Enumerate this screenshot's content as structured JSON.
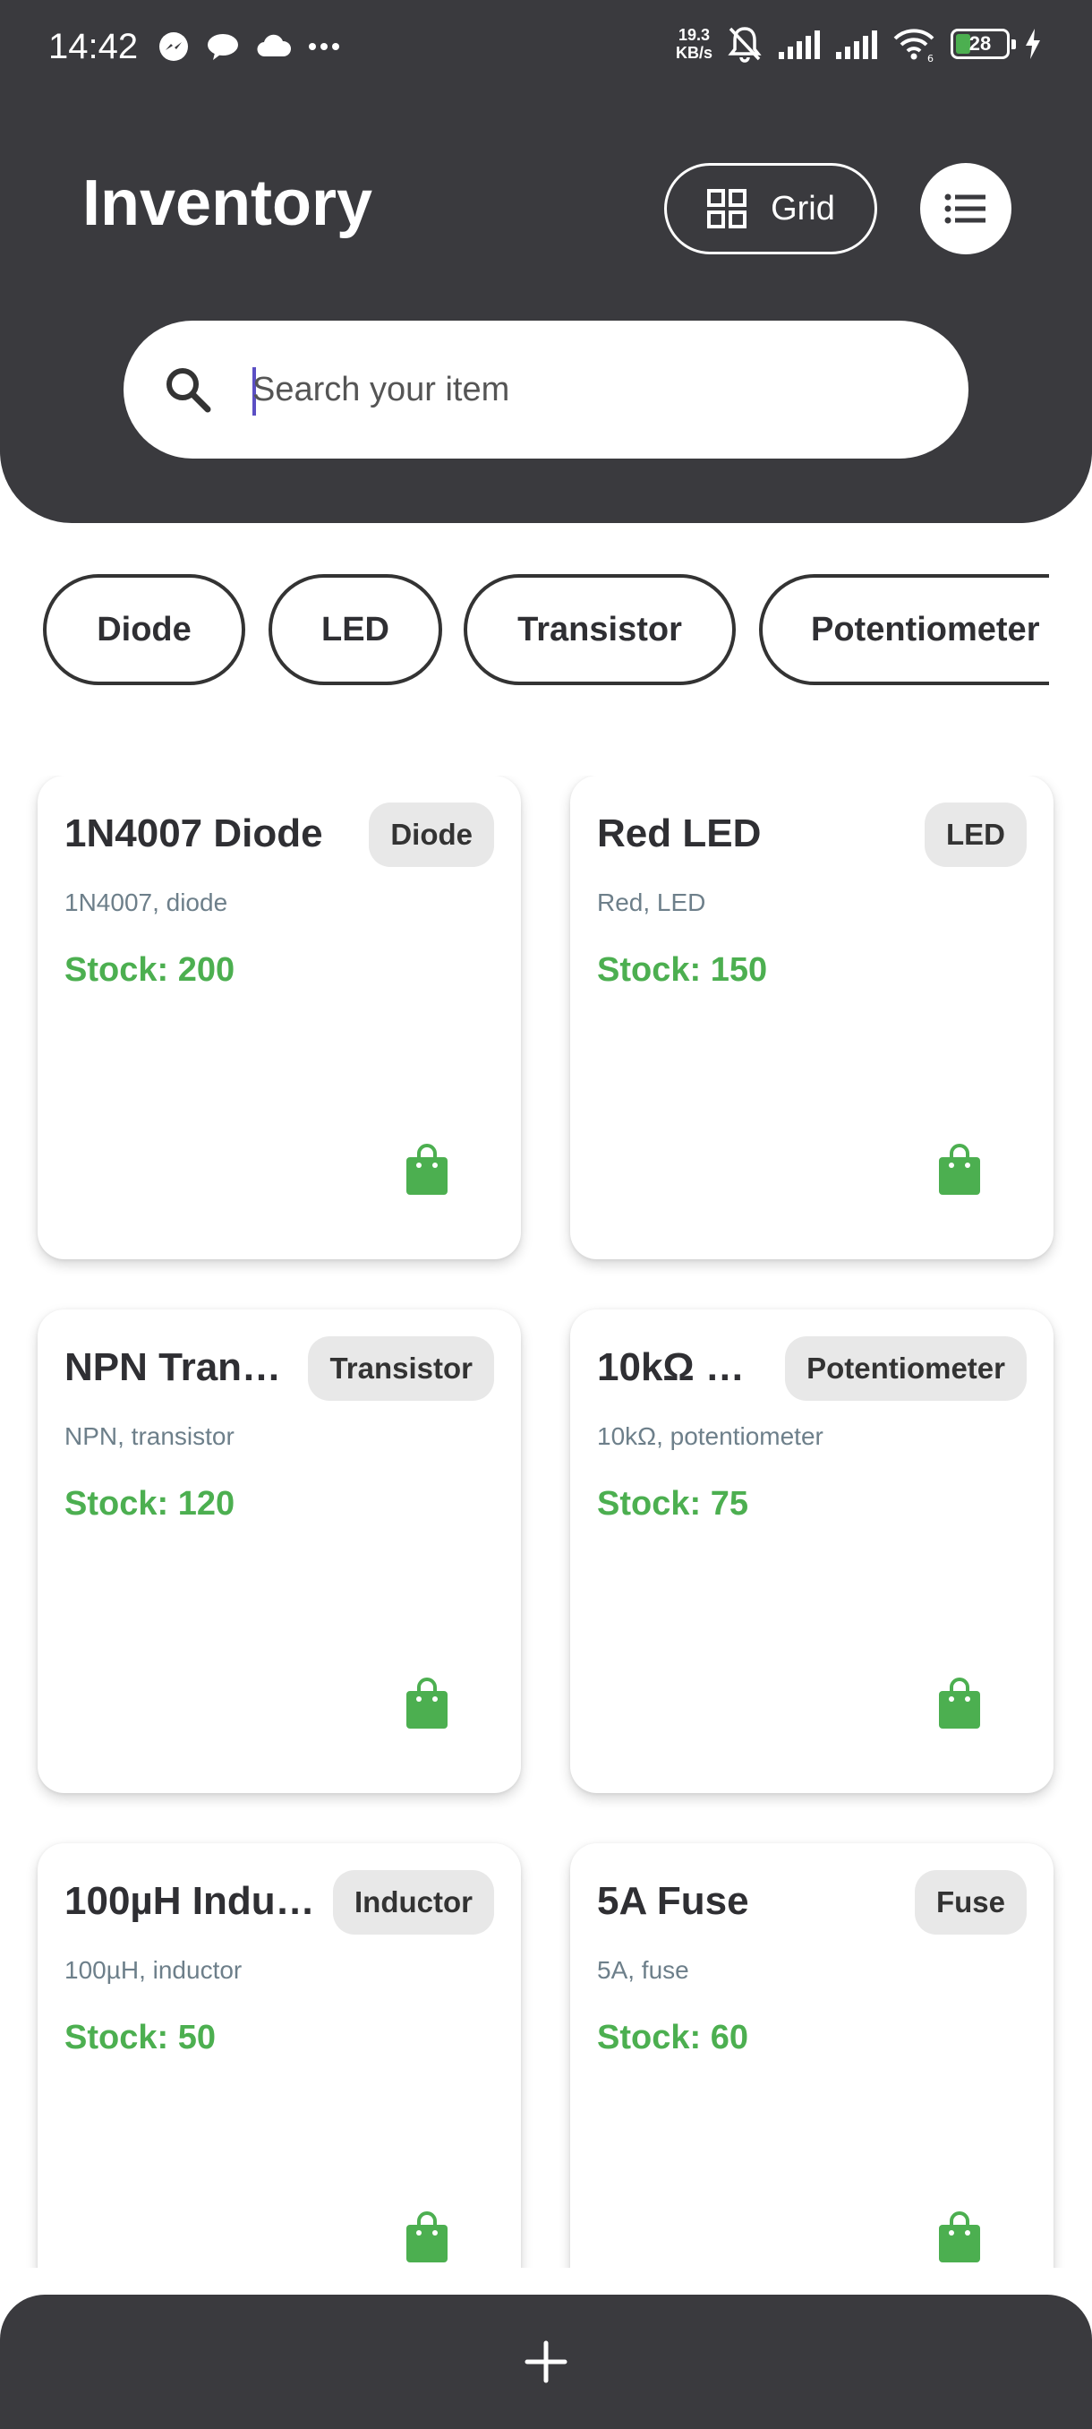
{
  "status_bar": {
    "time": "14:42",
    "net_speed_value": "19.3",
    "net_speed_unit": "KB/s",
    "battery_level": "28",
    "wifi_sub": "6"
  },
  "header": {
    "title": "Inventory",
    "view_toggle_label": "Grid"
  },
  "search": {
    "placeholder": "Search your item",
    "value": ""
  },
  "filters": [
    "Diode",
    "LED",
    "Transistor",
    "Potentiometer"
  ],
  "items": [
    {
      "name": "1N4007 Diode",
      "badge": "Diode",
      "desc": "1N4007, diode",
      "stock": "Stock: 200"
    },
    {
      "name": "Red LED",
      "badge": "LED",
      "desc": "Red, LED",
      "stock": "Stock: 150"
    },
    {
      "name": "NPN Tran…",
      "badge": "Transistor",
      "desc": "NPN, transistor",
      "stock": "Stock: 120"
    },
    {
      "name": "10kΩ …",
      "badge": "Potentiometer",
      "desc": "10kΩ, potentiometer",
      "stock": "Stock: 75"
    },
    {
      "name": "100µH Indu…",
      "badge": "Inductor",
      "desc": "100µH, inductor",
      "stock": "Stock: 50"
    },
    {
      "name": "5A Fuse",
      "badge": "Fuse",
      "desc": "5A, fuse",
      "stock": "Stock: 60"
    }
  ],
  "colors": {
    "header_bg": "#3a3a3e",
    "stock_green": "#4caf50",
    "badge_bg": "#e8e8e8",
    "cursor": "#5b4fc4"
  },
  "icons": {
    "view_toggle": "grid-icon",
    "menu": "list-icon",
    "search": "search-icon",
    "card_action": "shopping-bag-icon",
    "add": "plus-icon"
  }
}
